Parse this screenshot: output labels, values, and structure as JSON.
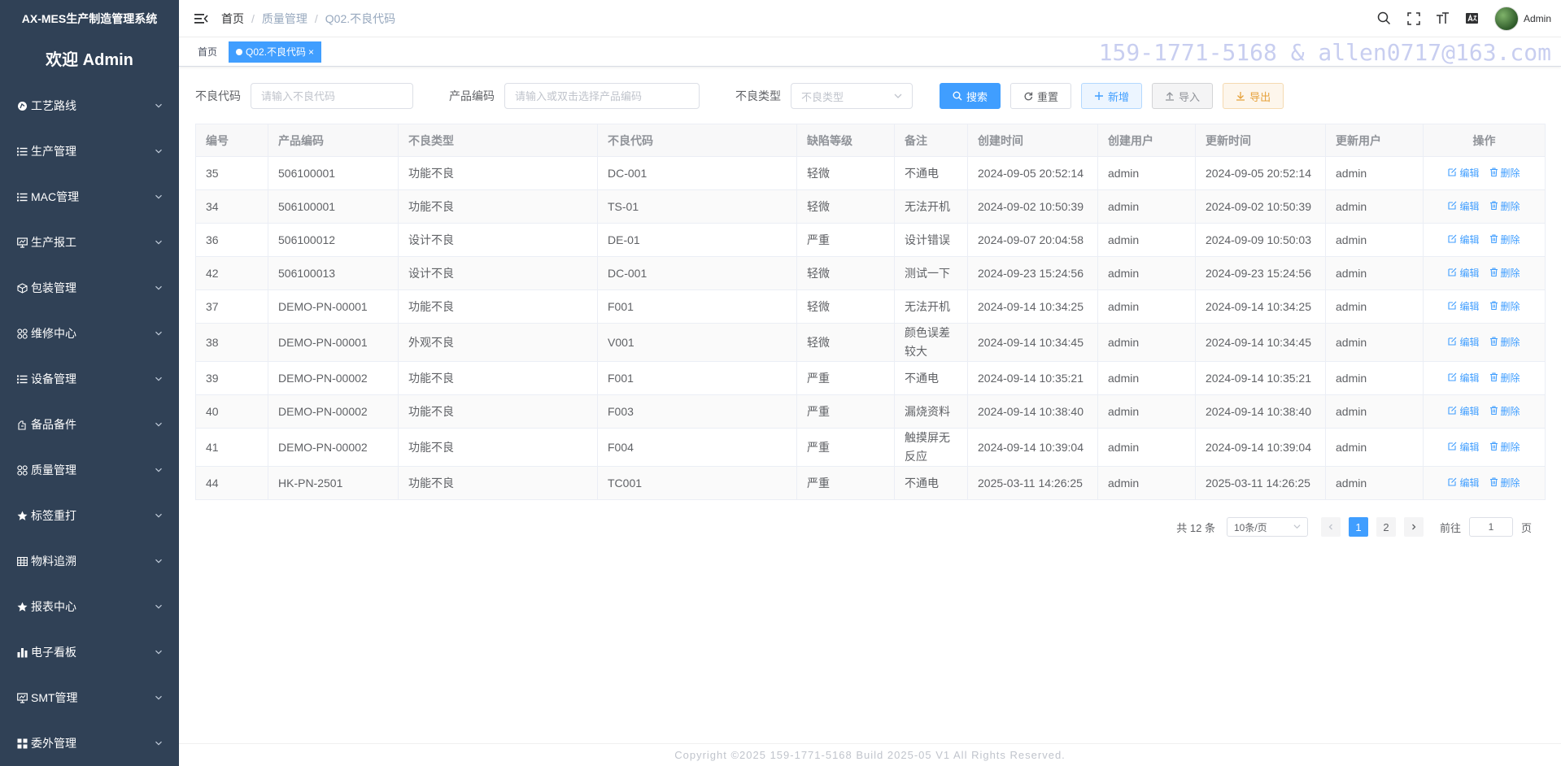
{
  "app": {
    "brand": "AX-MES生产制造管理系统",
    "welcome": "欢迎 Admin",
    "colors": {
      "sidebar_bg": "#304156",
      "accent": "#409eff"
    }
  },
  "sidebar": {
    "items": [
      {
        "label": "工艺路线",
        "icon": "route-icon"
      },
      {
        "label": "生产管理",
        "icon": "list-icon"
      },
      {
        "label": "MAC管理",
        "icon": "list-icon"
      },
      {
        "label": "生产报工",
        "icon": "monitor-icon"
      },
      {
        "label": "包装管理",
        "icon": "box-icon"
      },
      {
        "label": "维修中心",
        "icon": "grid-icon"
      },
      {
        "label": "设备管理",
        "icon": "list-icon"
      },
      {
        "label": "备品备件",
        "icon": "parts-icon"
      },
      {
        "label": "质量管理",
        "icon": "grid-icon"
      },
      {
        "label": "标签重打",
        "icon": "star-icon"
      },
      {
        "label": "物料追溯",
        "icon": "table-icon"
      },
      {
        "label": "报表中心",
        "icon": "star-icon"
      },
      {
        "label": "电子看板",
        "icon": "bar-chart-icon"
      },
      {
        "label": "SMT管理",
        "icon": "monitor-icon"
      },
      {
        "label": "委外管理",
        "icon": "apps-icon"
      }
    ]
  },
  "navbar": {
    "breadcrumb": [
      "首页",
      "质量管理",
      "Q02.不良代码"
    ],
    "user": "Admin"
  },
  "tags": {
    "home": "首页",
    "active": "Q02.不良代码",
    "close": "×"
  },
  "watermark": "159-1771-5168 & allen0717@163.com",
  "search": {
    "code_label": "不良代码",
    "code_placeholder": "请输入不良代码",
    "product_label": "产品编码",
    "product_placeholder": "请输入或双击选择产品编码",
    "type_label": "不良类型",
    "type_placeholder": "不良类型",
    "btn_search": "搜索",
    "btn_reset": "重置",
    "btn_add": "新增",
    "btn_import": "导入",
    "btn_export": "导出"
  },
  "table": {
    "headers": [
      "编号",
      "产品编码",
      "不良类型",
      "不良代码",
      "缺陷等级",
      "备注",
      "创建时间",
      "创建用户",
      "更新时间",
      "更新用户",
      "操作"
    ],
    "edit_label": "编辑",
    "delete_label": "删除",
    "rows": [
      [
        "35",
        "506100001",
        "功能不良",
        "DC-001",
        "轻微",
        "不通电",
        "2024-09-05 20:52:14",
        "admin",
        "2024-09-05 20:52:14",
        "admin"
      ],
      [
        "34",
        "506100001",
        "功能不良",
        "TS-01",
        "轻微",
        "无法开机",
        "2024-09-02 10:50:39",
        "admin",
        "2024-09-02 10:50:39",
        "admin"
      ],
      [
        "36",
        "506100012",
        "设计不良",
        "DE-01",
        "严重",
        "设计错误",
        "2024-09-07 20:04:58",
        "admin",
        "2024-09-09 10:50:03",
        "admin"
      ],
      [
        "42",
        "506100013",
        "设计不良",
        "DC-001",
        "轻微",
        "测试一下",
        "2024-09-23 15:24:56",
        "admin",
        "2024-09-23 15:24:56",
        "admin"
      ],
      [
        "37",
        "DEMO-PN-00001",
        "功能不良",
        "F001",
        "轻微",
        "无法开机",
        "2024-09-14 10:34:25",
        "admin",
        "2024-09-14 10:34:25",
        "admin"
      ],
      [
        "38",
        "DEMO-PN-00001",
        "外观不良",
        "V001",
        "轻微",
        "颜色误差较大",
        "2024-09-14 10:34:45",
        "admin",
        "2024-09-14 10:34:45",
        "admin"
      ],
      [
        "39",
        "DEMO-PN-00002",
        "功能不良",
        "F001",
        "严重",
        "不通电",
        "2024-09-14 10:35:21",
        "admin",
        "2024-09-14 10:35:21",
        "admin"
      ],
      [
        "40",
        "DEMO-PN-00002",
        "功能不良",
        "F003",
        "严重",
        "漏烧资料",
        "2024-09-14 10:38:40",
        "admin",
        "2024-09-14 10:38:40",
        "admin"
      ],
      [
        "41",
        "DEMO-PN-00002",
        "功能不良",
        "F004",
        "严重",
        "触摸屏无反应",
        "2024-09-14 10:39:04",
        "admin",
        "2024-09-14 10:39:04",
        "admin"
      ],
      [
        "44",
        "HK-PN-2501",
        "功能不良",
        "TC001",
        "严重",
        "不通电",
        "2025-03-11 14:26:25",
        "admin",
        "2025-03-11 14:26:25",
        "admin"
      ]
    ]
  },
  "pagination": {
    "total": "共 12 条",
    "page_size": "10条/页",
    "pages": [
      "1",
      "2"
    ],
    "current": "1",
    "goto_label": "前往",
    "goto_value": "1",
    "page_suffix": "页"
  },
  "footer": "Copyright ©2025 159-1771-5168 Build 2025-05 V1 All Rights Reserved."
}
